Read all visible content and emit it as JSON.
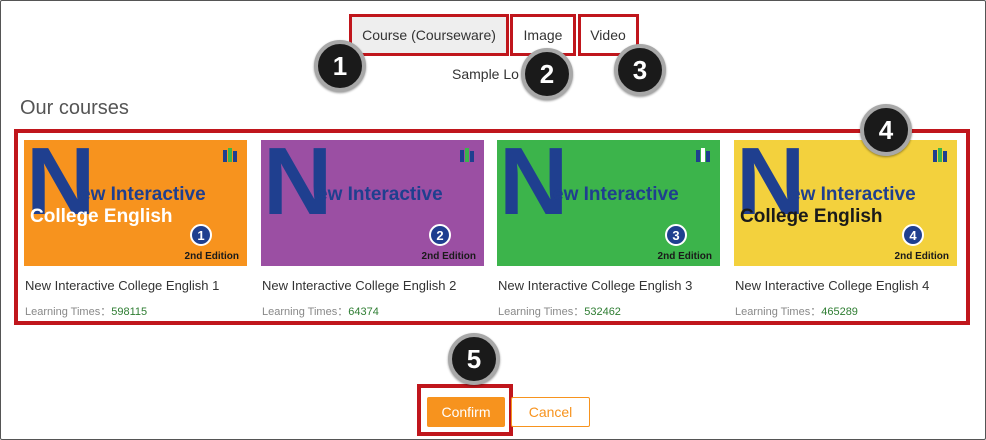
{
  "tabs": [
    {
      "label": "Course (Courseware)"
    },
    {
      "label": "Image"
    },
    {
      "label": "Video"
    }
  ],
  "sample_text": "Sample Lo",
  "section_title": "Our courses",
  "callouts": [
    "1",
    "2",
    "3",
    "4",
    "5"
  ],
  "courses": [
    {
      "cover_line1": "ew Interactive",
      "cover_line2": "College English",
      "cover_big": "N",
      "cover_number": "1",
      "edition": "2nd Edition",
      "name": "New Interactive College English 1",
      "times_label": "Learning Times：",
      "times_value": "598115",
      "bg": "#f7931e",
      "line2_color": "#ffffff"
    },
    {
      "cover_line1": "ew Interactive",
      "cover_line2": "",
      "cover_big": "N",
      "cover_number": "2",
      "edition": "2nd Edition",
      "name": "New Interactive College English 2",
      "times_label": "Learning Times：",
      "times_value": "64374",
      "bg": "#9b4fa3",
      "line2_color": "#ffffff"
    },
    {
      "cover_line1": "ew Interactive",
      "cover_line2": "",
      "cover_big": "N",
      "cover_number": "3",
      "edition": "2nd Edition",
      "name": "New Interactive College English 3",
      "times_label": "Learning Times：",
      "times_value": "532462",
      "bg": "#3cb44b",
      "line2_color": "#ffffff"
    },
    {
      "cover_line1": "ew Interactive",
      "cover_line2": "College English",
      "cover_big": "N",
      "cover_number": "4",
      "edition": "2nd Edition",
      "name": "New Interactive College English 4",
      "times_label": "Learning Times：",
      "times_value": "465289",
      "bg": "#f3d13d",
      "line2_color": "#1a1a1a"
    }
  ],
  "buttons": {
    "confirm": "Confirm",
    "cancel": "Cancel"
  },
  "colors": {
    "accent": "#f7931e",
    "highlight": "#c0161c",
    "cover_blue": "#1f3f8f",
    "times_value": "#2e7d32"
  }
}
